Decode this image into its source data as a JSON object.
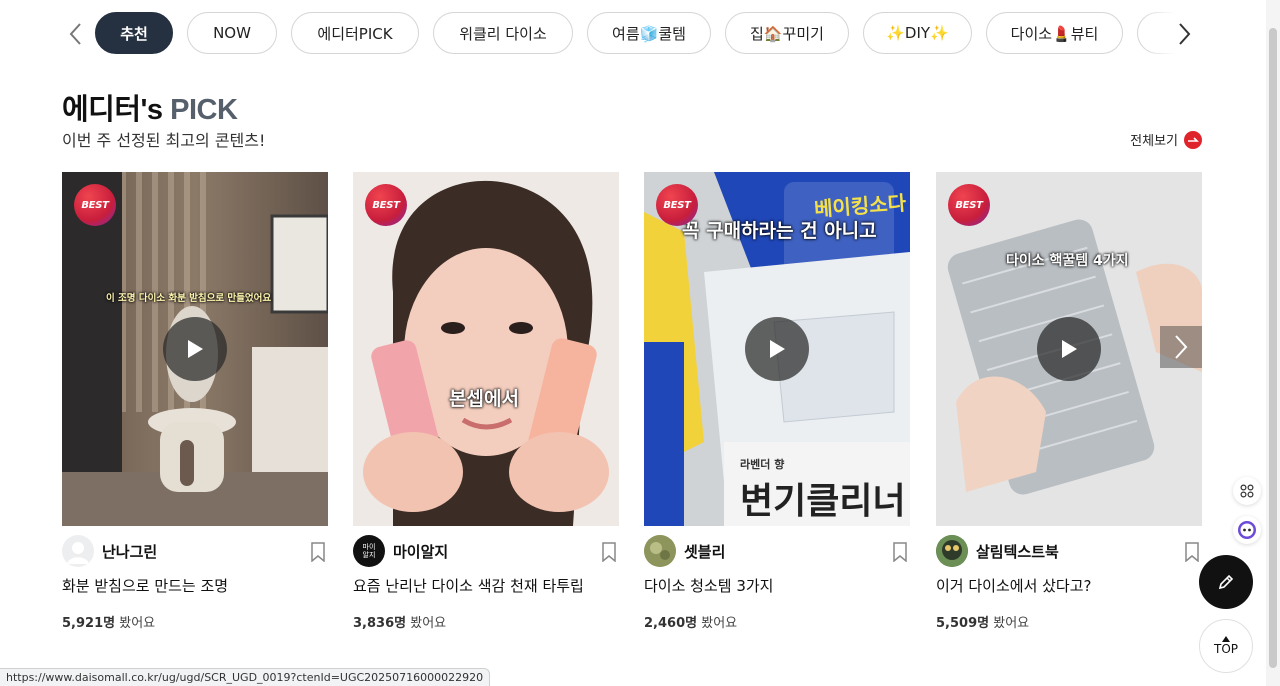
{
  "tabs": {
    "items": [
      "추천",
      "NOW",
      "에디터PICK",
      "위클리 다이소",
      "여름🧊쿨템",
      "집🏠꾸미기",
      "✨DIY✨",
      "다이소💄뷰티",
      "🗝️"
    ],
    "active": "추천"
  },
  "section": {
    "title_main": "에디터's",
    "title_accent": "PICK",
    "subtitle": "이번 주 선정된 최고의 콘텐츠!",
    "see_all": "전체보기"
  },
  "cards": [
    {
      "badge": "BEST",
      "caption": "이 조명 다이소 화분 받침으로 만들었어요",
      "author": "난나그린",
      "title": "화분 받침으로 만드는 조명",
      "views_count": "5,921명",
      "views_suffix": "봤어요"
    },
    {
      "badge": "BEST",
      "caption": "본셉에서",
      "author": "마이알지",
      "avatar_text": "마이\n알지",
      "title": "요즘 난리난 다이소 색감 천재 타투립",
      "views_count": "3,836명",
      "views_suffix": "봤어요"
    },
    {
      "badge": "BEST",
      "caption": "꼭 구매하라는 건 아니고",
      "pkg_text_1": "베이킹소다",
      "pkg_text_2": "변기클리너",
      "pkg_text_3": "라벤더 향",
      "author": "셋블리",
      "title": "다이소 청소템 3가지",
      "views_count": "2,460명",
      "views_suffix": "봤어요"
    },
    {
      "badge": "BEST",
      "caption": "다이소 핵꿀템 4가지",
      "author": "살림텍스트북",
      "title": "이거 다이소에서 샀다고?",
      "views_count": "5,509명",
      "views_suffix": "봤어요"
    }
  ],
  "widgets": {
    "top_label": "TOP"
  },
  "status_bar": {
    "url": "https://www.daisomall.co.kr/ug/ugd/SCR_UGD_0019?ctenId=UGC20250716000022920"
  },
  "colors": {
    "active_chip": "#253140",
    "title_accent": "#56606c",
    "see_all_icon": "#e0242c",
    "best_badge": "#c81e3c"
  }
}
